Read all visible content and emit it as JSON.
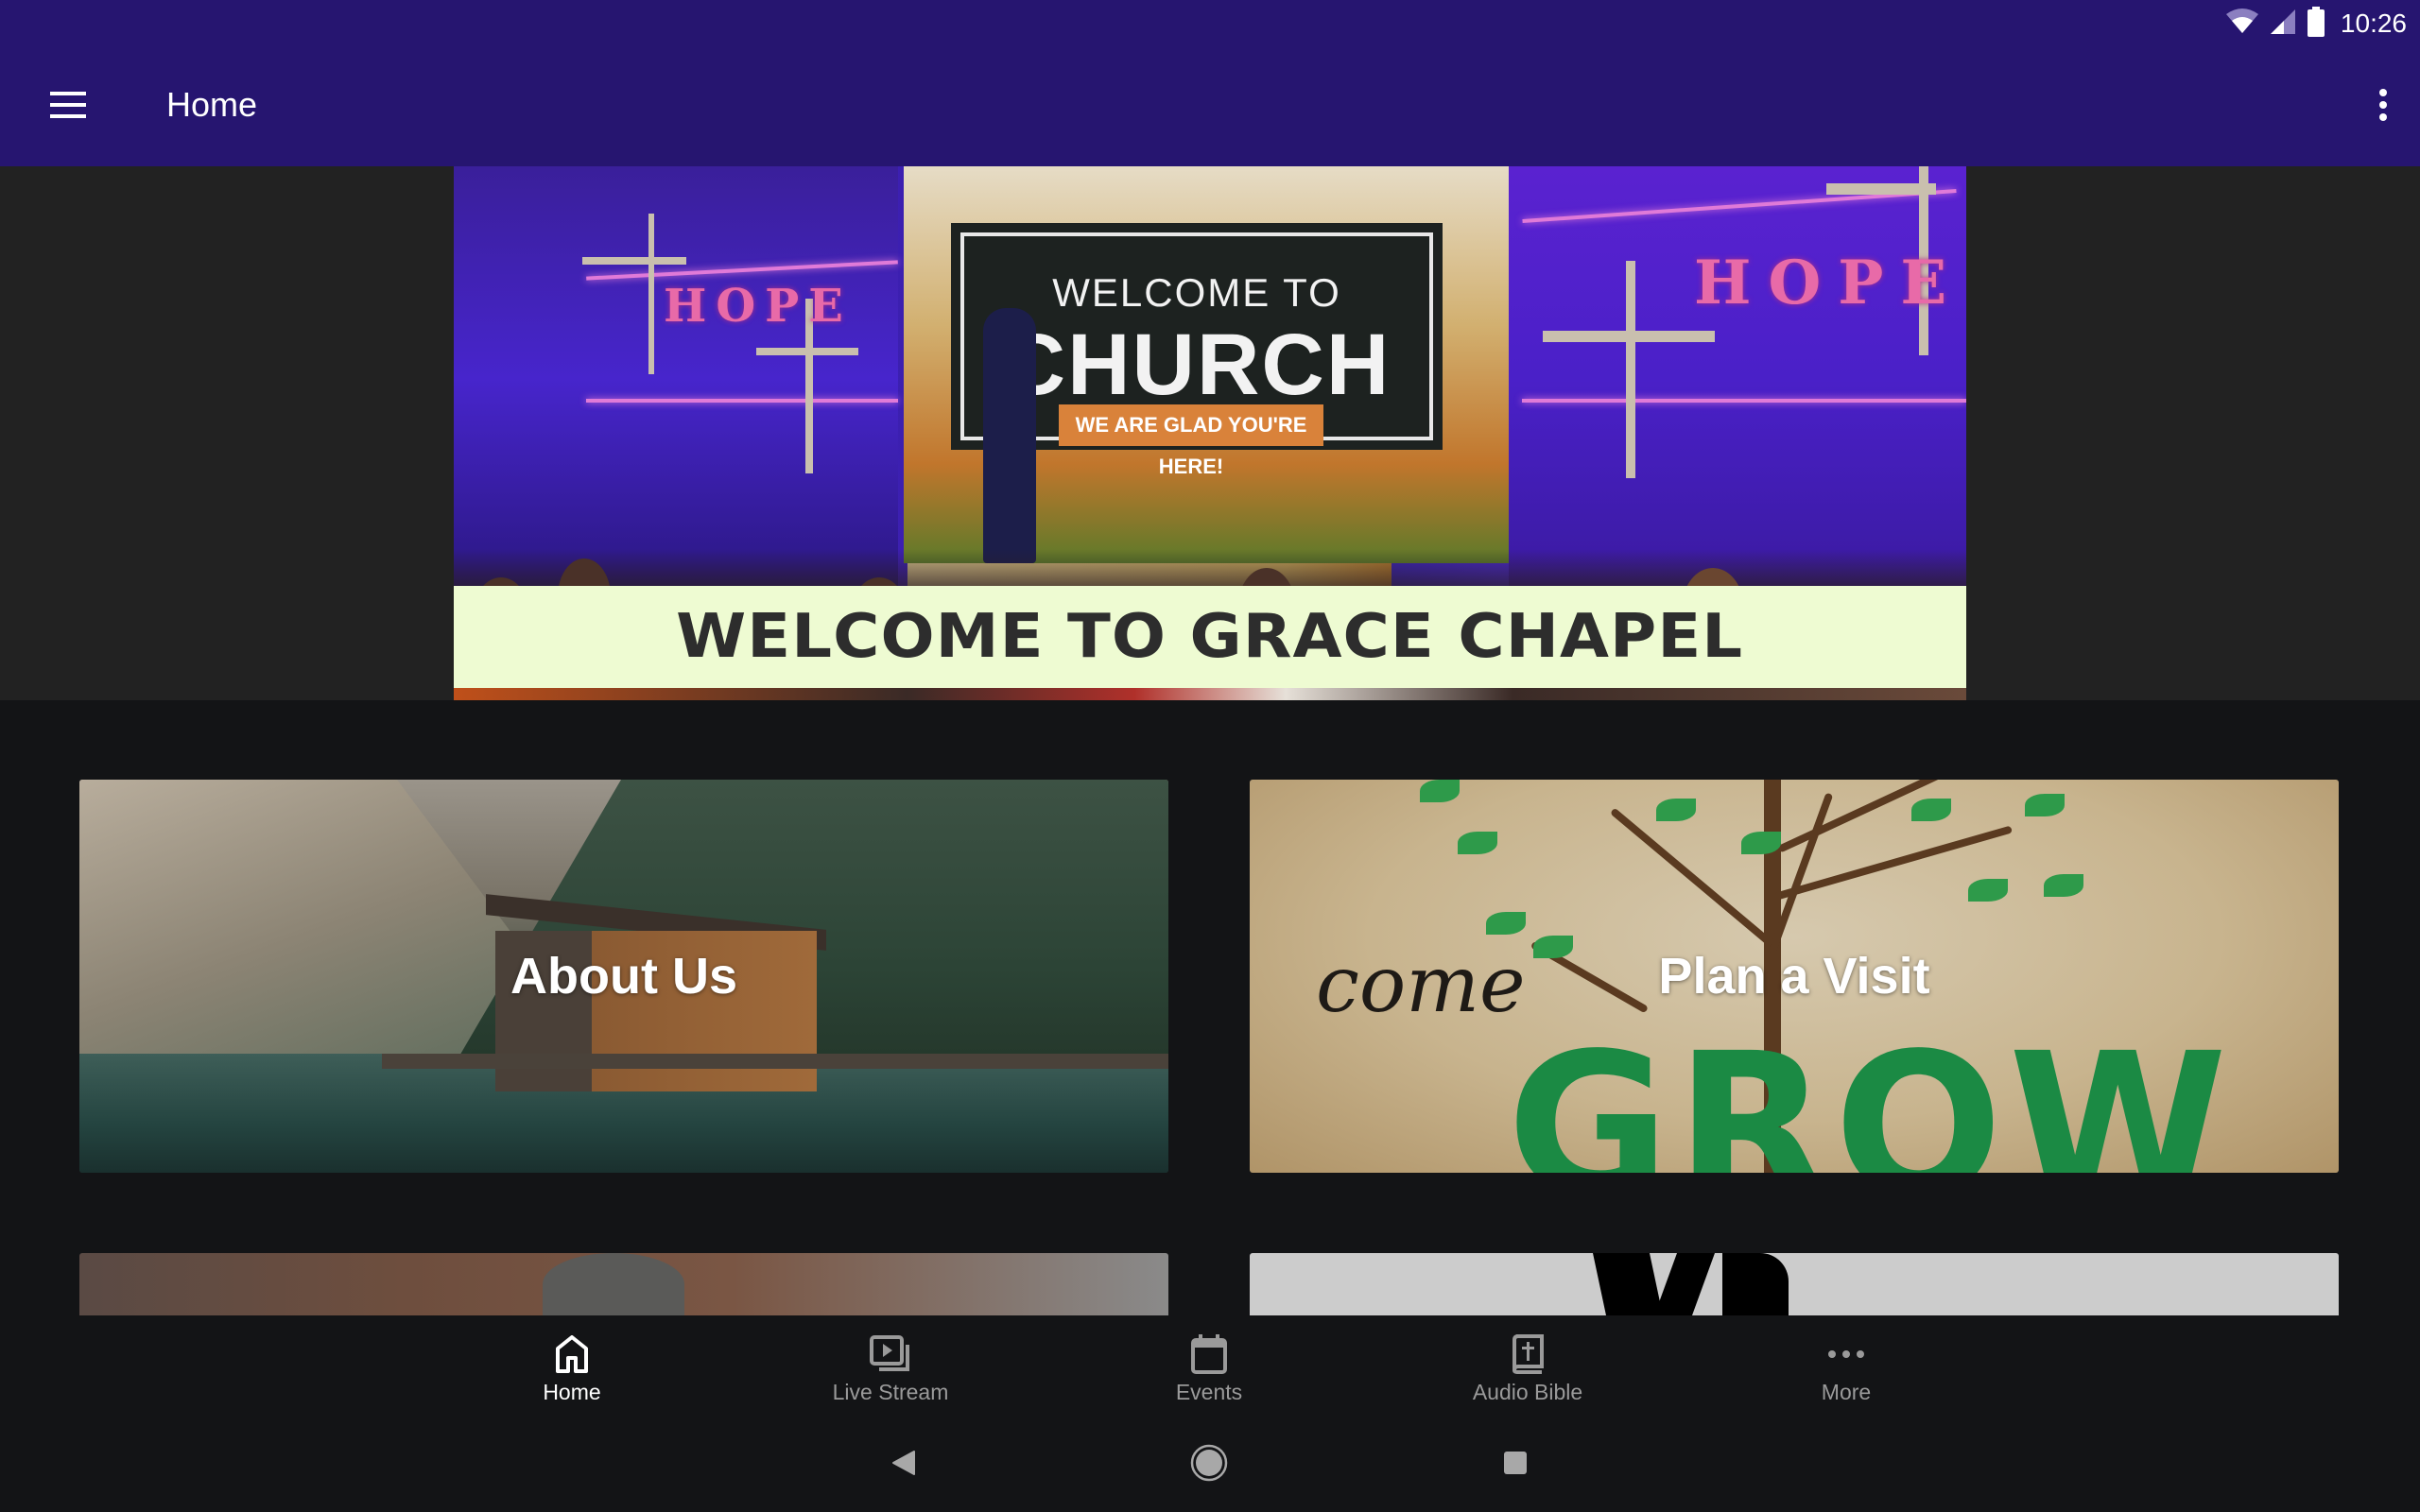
{
  "status_bar": {
    "time": "10:26",
    "icons": [
      "wifi-icon",
      "cellular-signal-icon",
      "battery-icon"
    ]
  },
  "app_bar": {
    "title": "Home",
    "menu_icon": "hamburger-menu-icon",
    "overflow_icon": "more-vertical-icon",
    "background_color": "#261570"
  },
  "hero": {
    "banner_text": "WELCOME TO GRACE CHAPEL",
    "image_screen_line1": "WELCOME TO",
    "image_screen_line2": "CHURCH",
    "image_screen_tagline": "WE ARE GLAD YOU'RE HERE!",
    "image_sign_left": "HOPE",
    "image_sign_right": "HOPE",
    "banner_color": "#eefbd2"
  },
  "cards": [
    {
      "label": "About Us",
      "image": "lake-cabin-mountains"
    },
    {
      "label": "Plan a Visit",
      "image": "come-grow-tree",
      "image_text_script": "come",
      "image_text_big": "GROW"
    }
  ],
  "partial_cards": [
    {
      "image": "wooden-room-partial"
    },
    {
      "image": "black-silhouette-partial"
    }
  ],
  "bottom_nav": {
    "items": [
      {
        "label": "Home",
        "icon": "home-icon",
        "active": true
      },
      {
        "label": "Live Stream",
        "icon": "video-library-icon",
        "active": false
      },
      {
        "label": "Events",
        "icon": "calendar-icon",
        "active": false
      },
      {
        "label": "Audio Bible",
        "icon": "bible-icon",
        "active": false
      },
      {
        "label": "More",
        "icon": "more-horizontal-icon",
        "active": false
      }
    ],
    "active_color": "#ffffff",
    "inactive_color": "#9a9a9a"
  },
  "system_nav": {
    "buttons": [
      "back-icon",
      "home-circle-icon",
      "recents-icon"
    ]
  }
}
